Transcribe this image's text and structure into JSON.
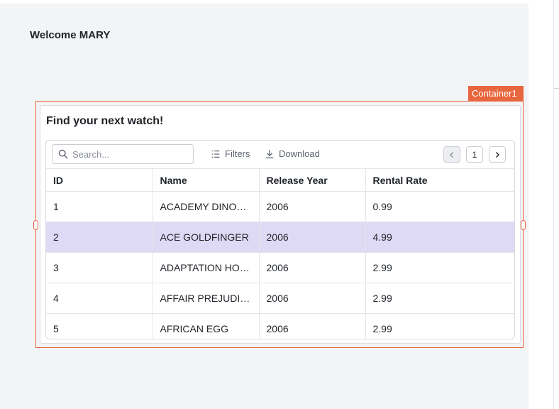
{
  "page": {
    "welcome": "Welcome MARY"
  },
  "selection": {
    "component_label": "Container1",
    "accent_color": "#e8663d"
  },
  "container": {
    "title": "Find your next watch!"
  },
  "toolbar": {
    "search_placeholder": "Search...",
    "search_value": "",
    "filters_label": "Filters",
    "download_label": "Download",
    "current_page": "1",
    "icons": [
      "search-icon",
      "filter-icon",
      "download-icon",
      "chevron-left-icon",
      "chevron-right-icon"
    ]
  },
  "table": {
    "columns": [
      "ID",
      "Name",
      "Release Year",
      "Rental Rate"
    ],
    "selected_row": 1,
    "selected_color": "#dedaf5",
    "rows": [
      [
        "1",
        "ACADEMY DINOSAUR",
        "2006",
        "0.99"
      ],
      [
        "2",
        "ACE GOLDFINGER",
        "2006",
        "4.99"
      ],
      [
        "3",
        "ADAPTATION HOLES",
        "2006",
        "2.99"
      ],
      [
        "4",
        "AFFAIR PREJUDICE",
        "2006",
        "2.99"
      ],
      [
        "5",
        "AFRICAN EGG",
        "2006",
        "2.99"
      ]
    ]
  }
}
